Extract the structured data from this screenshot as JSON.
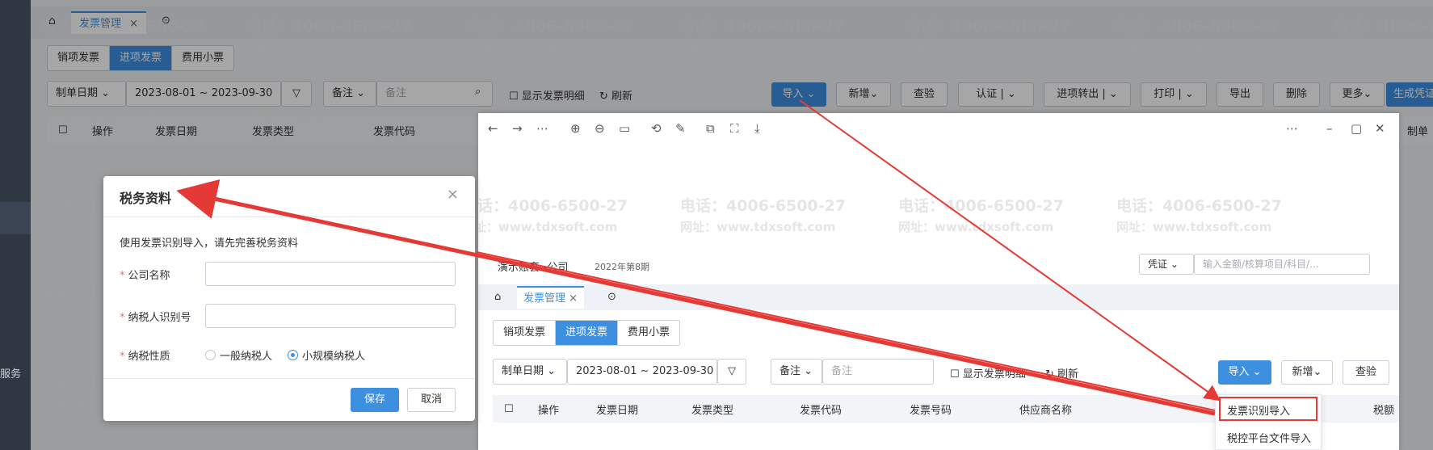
{
  "sidebar": {
    "service_label": "服务"
  },
  "bg": {
    "tab_label": "发票管理",
    "seg": [
      "销项发票",
      "进项发票",
      "费用小票"
    ],
    "date_type": "制单日期",
    "date_range": "2023-08-01 ~ 2023-09-30",
    "remark_label": "备注",
    "remark_placeholder": "备注",
    "show_detail": "显示发票明细",
    "refresh": "刷新",
    "toolbar": [
      "导入",
      "新增",
      "查验",
      "认证",
      "进项转出",
      "打印",
      "导出",
      "删除",
      "更多",
      "生成凭证"
    ],
    "columns": [
      "操作",
      "发票日期",
      "发票类型",
      "发票代码"
    ],
    "right_col": "制单"
  },
  "watermark": {
    "phone": "电话：4006-6500-27",
    "site": "网址：www.tdxsoft.com"
  },
  "dialog": {
    "title": "税务资料",
    "note": "使用发票识别导入，请先完善税务资料",
    "company_label": "公司名称",
    "taxid_label": "纳税人识别号",
    "nature_label": "纳税性质",
    "opt_general": "一般纳税人",
    "opt_small": "小规模纳税人",
    "selected": "小规模纳税人",
    "save": "保存",
    "cancel": "取消"
  },
  "shot": {
    "company": "演示账套--公司",
    "period": "2022年第8期",
    "voucher_select": "凭证",
    "search_placeholder": "输入金额/核算项目/科目/...",
    "tab_label": "发票管理",
    "seg": [
      "销项发票",
      "进项发票",
      "费用小票"
    ],
    "date_type": "制单日期",
    "date_range": "2023-08-01 ~ 2023-09-30",
    "remark_label": "备注",
    "remark_placeholder": "备注",
    "show_detail": "显示发票明细",
    "refresh": "刷新",
    "import": "导入",
    "add": "新增",
    "check": "查验",
    "columns": [
      "操作",
      "发票日期",
      "发票类型",
      "发票代码",
      "发票号码",
      "供应商名称",
      "税额"
    ],
    "menu": [
      "发票识别导入",
      "税控平台文件导入"
    ]
  },
  "colors": {
    "primary": "#3d8fe0",
    "arrow": "#e53935",
    "highlight": "#e53935"
  }
}
